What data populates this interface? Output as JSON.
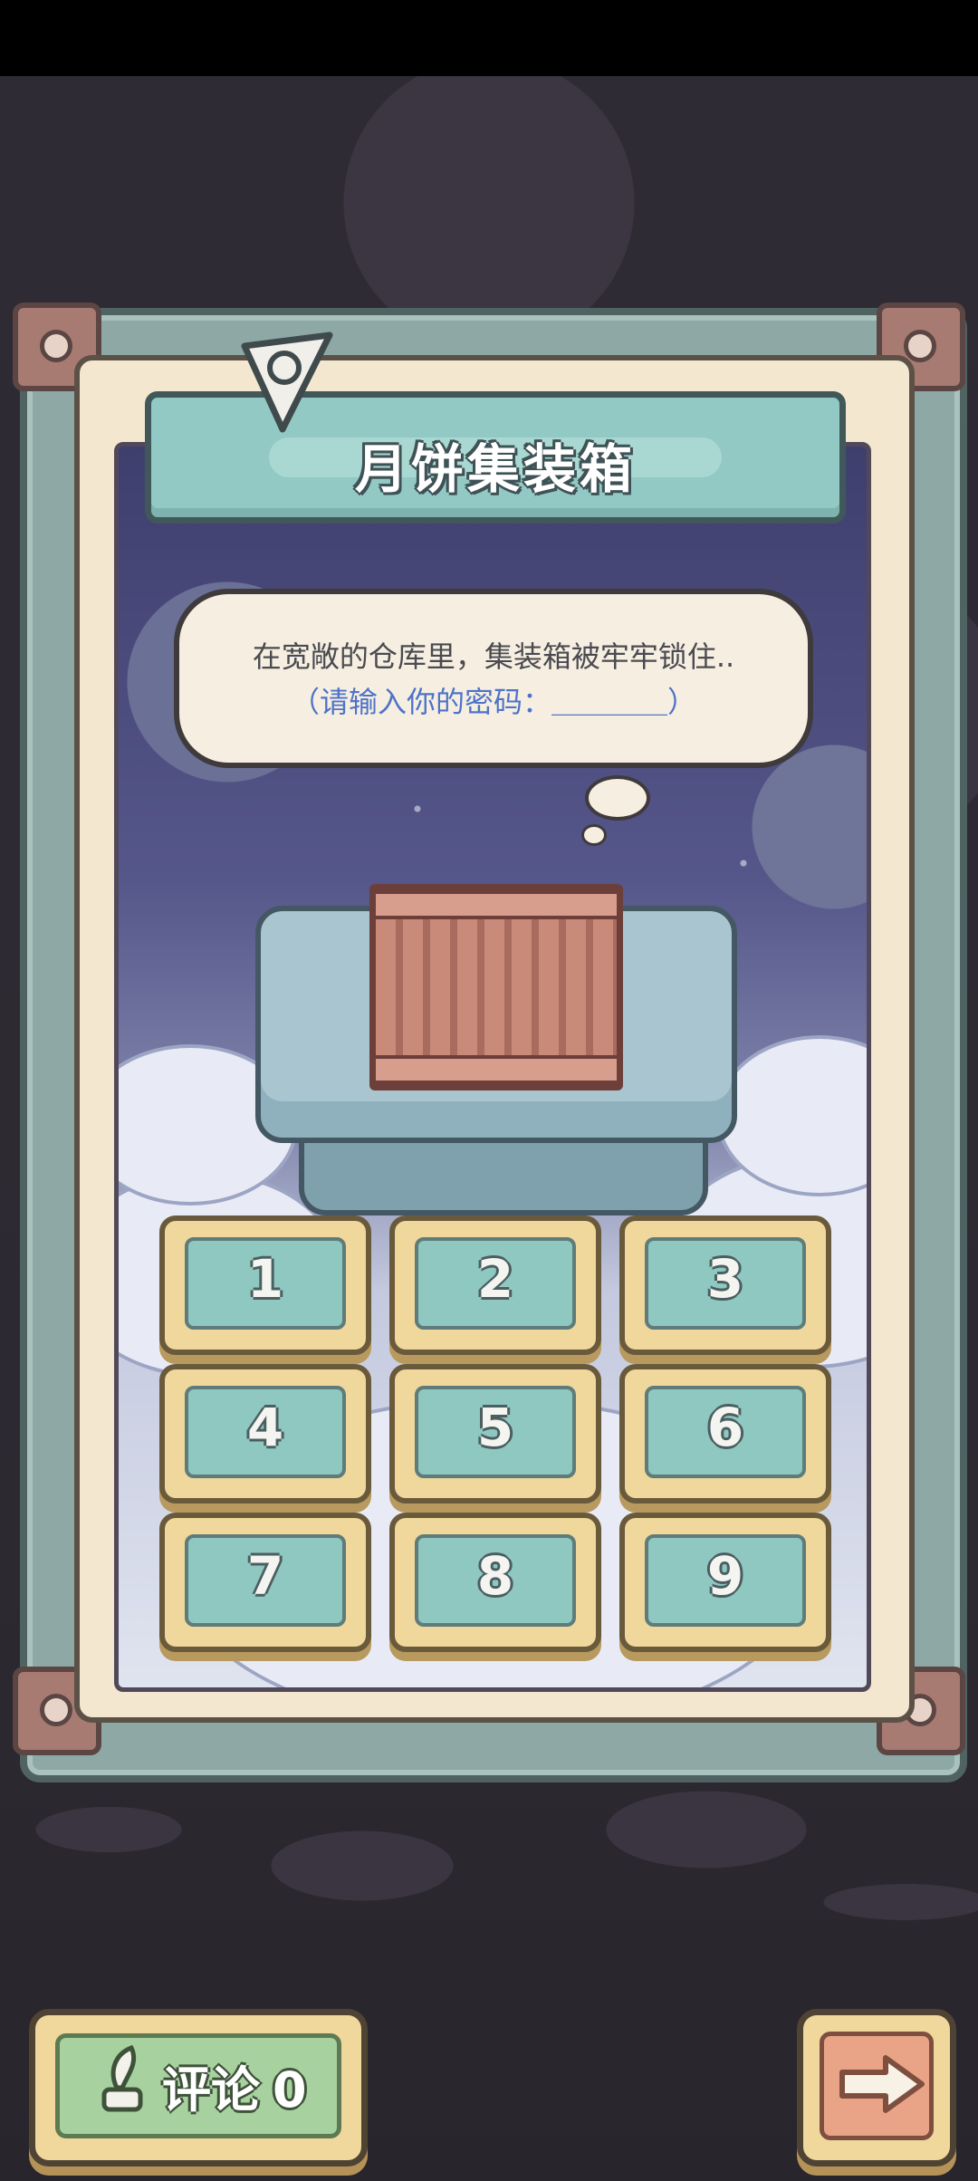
{
  "panel": {
    "title": "月饼集装箱",
    "bubble_line1": "在宽敞的仓库里，集装箱被牢牢锁住..",
    "bubble_line2": "（请输入你的密码：＿＿＿＿）"
  },
  "keypad": [
    "1",
    "2",
    "3",
    "4",
    "5",
    "6",
    "7",
    "8",
    "9"
  ],
  "footer": {
    "comment_label": "评论",
    "comment_count": "0",
    "comment_icon": "feather-icon",
    "next_icon": "arrow-right-icon"
  },
  "colors": {
    "bubble_prompt": "#4f73c9",
    "key_face": "#8fc7c1",
    "comment_button": "#a7d19e",
    "next_button": "#e9a487"
  }
}
